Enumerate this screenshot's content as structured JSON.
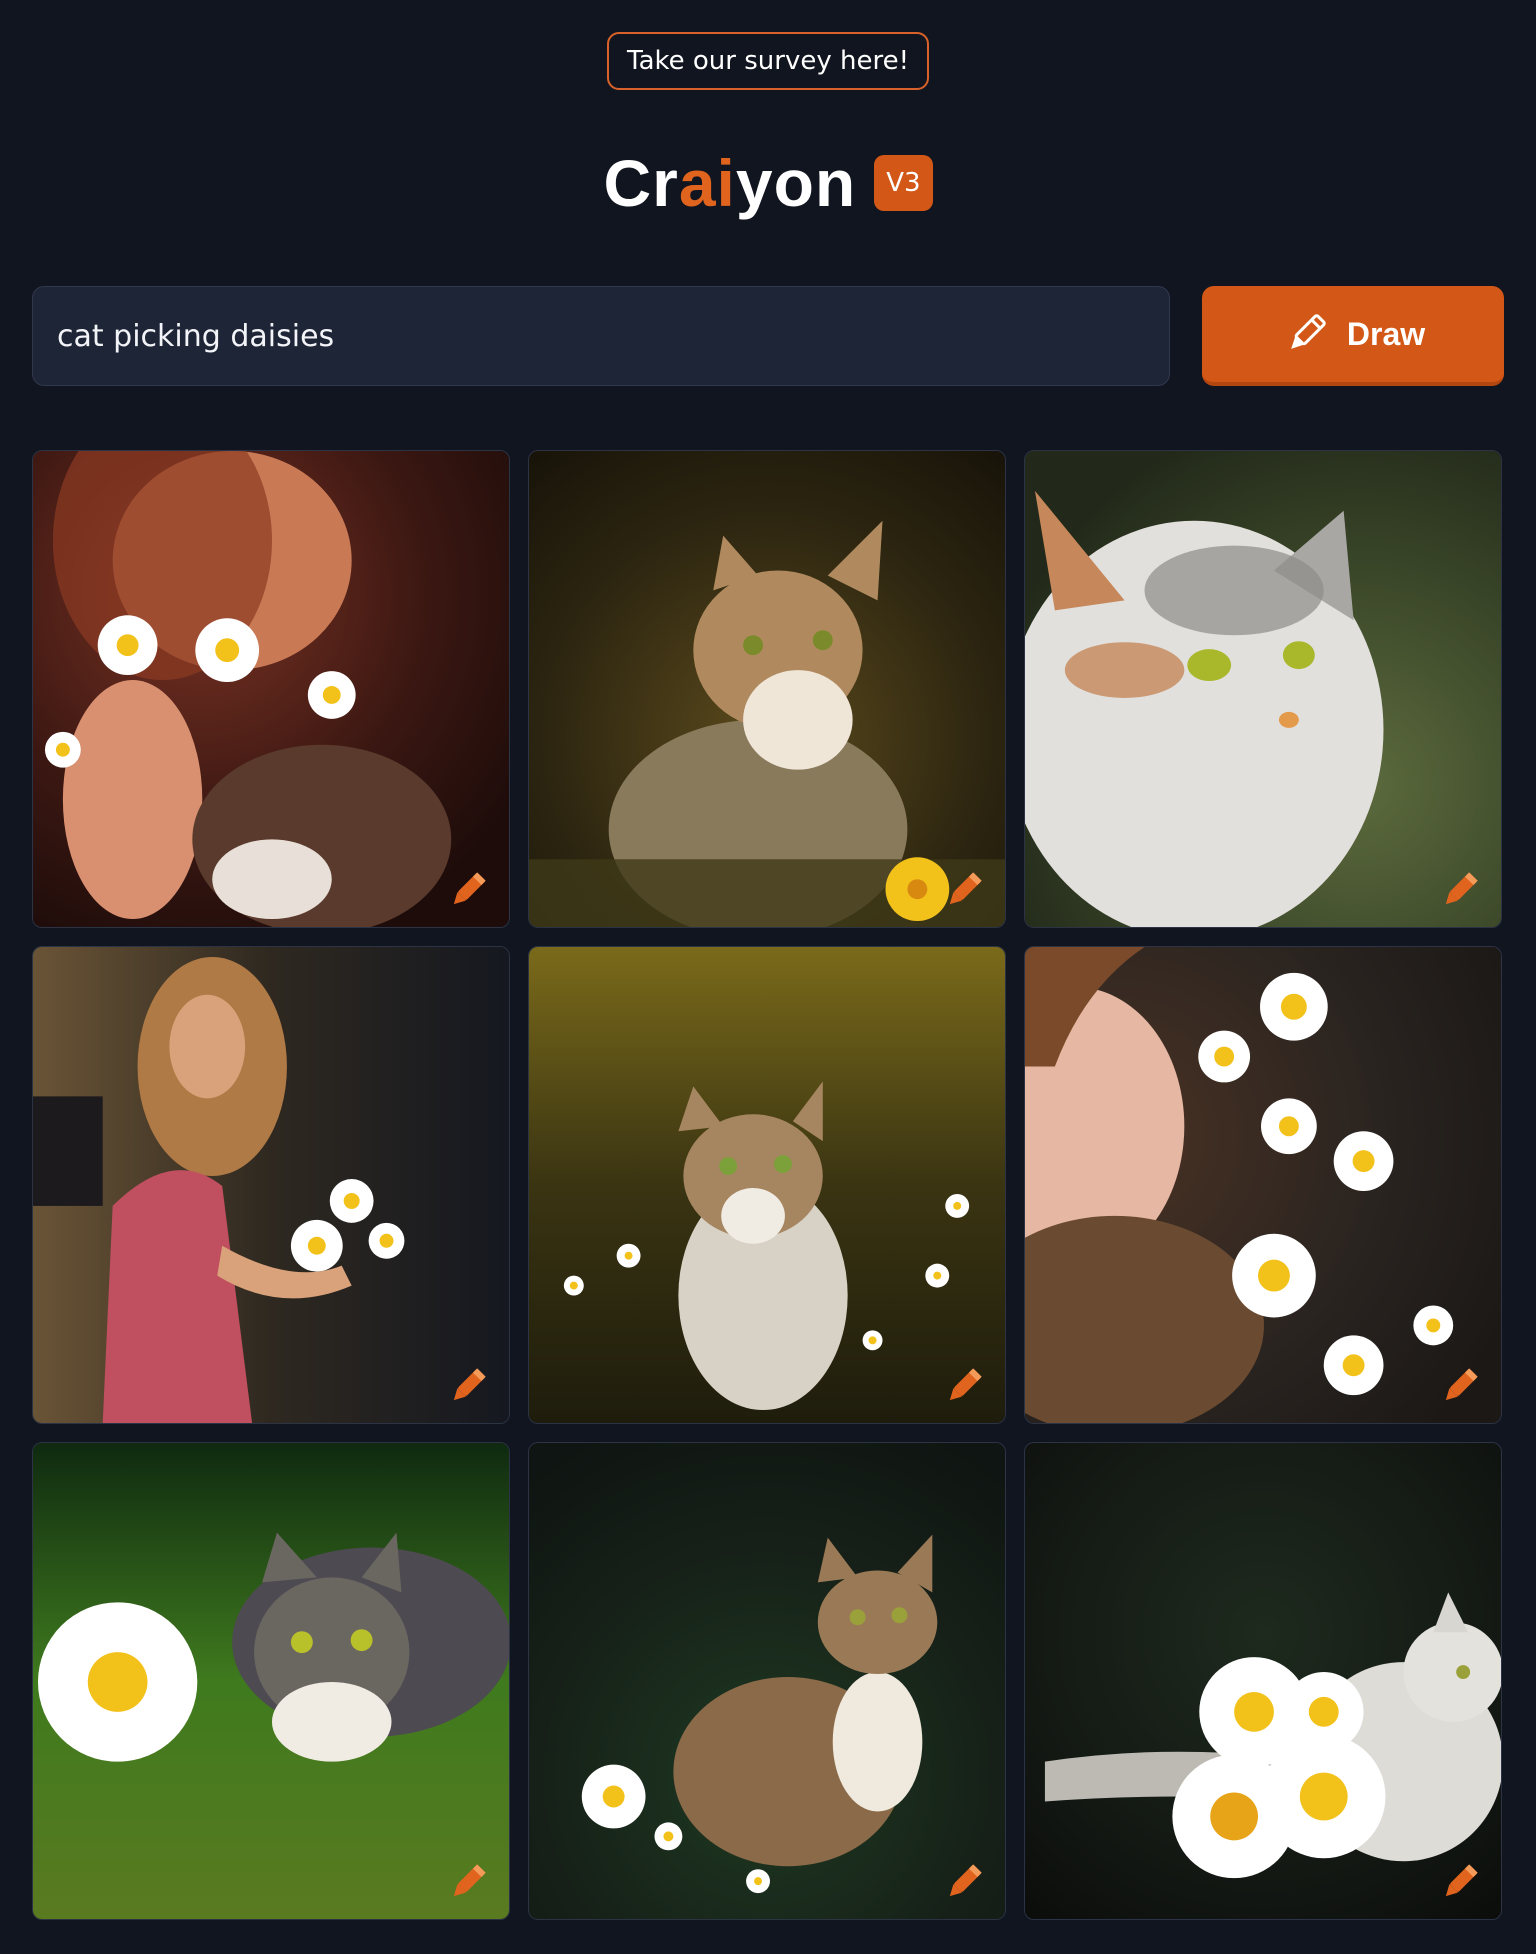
{
  "survey": {
    "label": "Take our survey here!"
  },
  "logo": {
    "part1": "Cr",
    "part2": "ai",
    "part3": "yon",
    "version": "V3"
  },
  "prompt": {
    "value": "cat picking daisies"
  },
  "draw_button": {
    "label": "Draw"
  },
  "colors": {
    "background": "#11151f",
    "accent": "#d35716",
    "input_bg": "#1e2536"
  },
  "results": [
    {
      "subject": "woman holding daisies with cat",
      "icon": "pencil-edit-icon"
    },
    {
      "subject": "tabby cat among yellow flowers",
      "icon": "pencil-edit-icon"
    },
    {
      "subject": "calico cat close-up",
      "icon": "pencil-edit-icon"
    },
    {
      "subject": "woman in red dress holding daisies",
      "icon": "pencil-edit-icon"
    },
    {
      "subject": "cat sitting in daisy meadow",
      "icon": "pencil-edit-icon"
    },
    {
      "subject": "woman profile with floating daisies",
      "icon": "pencil-edit-icon"
    },
    {
      "subject": "tabby cat with large daisy on green",
      "icon": "pencil-edit-icon"
    },
    {
      "subject": "tabby cat walking with daisies",
      "icon": "pencil-edit-icon"
    },
    {
      "subject": "white cat behind daisies",
      "icon": "pencil-edit-icon"
    }
  ]
}
